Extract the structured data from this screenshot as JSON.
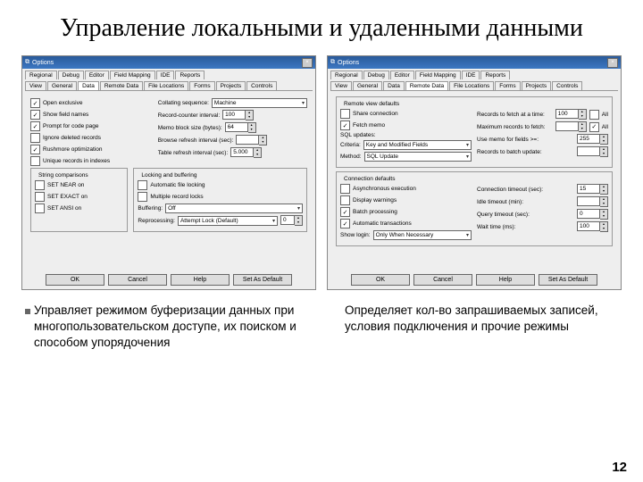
{
  "slide_title": "Управление локальными и удаленными данными",
  "caption_left": "Управляет режимом буферизации данных при многопользовательском доступе, их поиском и способом упорядочения",
  "caption_right": "Определяет кол-во запрашиваемых записей, условия подключения и прочие режимы",
  "page_number": "12",
  "left": {
    "title": "Options",
    "tabs1": [
      "Regional",
      "Debug",
      "Editor",
      "Field Mapping",
      "IDE",
      "Reports"
    ],
    "tabs2": [
      "View",
      "General",
      "Data",
      "Remote Data",
      "File Locations",
      "Forms",
      "Projects",
      "Controls"
    ],
    "sel_tab": 2,
    "open_exclusive": "Open exclusive",
    "show_field_names": "Show field names",
    "prompt_code_page": "Prompt for code page",
    "ignore_deleted": "Ignore deleted records",
    "rushmore": "Rushmore optimization",
    "unique_idx": "Unique records in indexes",
    "collating_lbl": "Collating sequence:",
    "collating_val": "Machine",
    "record_counter_lbl": "Record-counter interval:",
    "record_counter_val": "100",
    "memo_lbl": "Memo block size (bytes):",
    "memo_val": "64",
    "browse_refresh_lbl": "Browse refresh interval (sec):",
    "table_refresh_lbl": "Table refresh interval (sec):",
    "table_refresh_val": "5.000",
    "string_group": "String comparisons",
    "set_near": "SET NEAR on",
    "set_exact": "SET EXACT on",
    "set_ansi": "SET ANSI on",
    "locking_group": "Locking and buffering",
    "auto_lock": "Automatic file locking",
    "multi_lock": "Multiple record locks",
    "buffering_lbl": "Buffering:",
    "buffering_val": "Off",
    "reprocessing_lbl": "Reprocessing:",
    "reprocessing_val": "Attempt Lock (Default)",
    "reprocessing_n": "0"
  },
  "right": {
    "title": "Options",
    "tabs1": [
      "Regional",
      "Debug",
      "Editor",
      "Field Mapping",
      "IDE",
      "Reports"
    ],
    "tabs2": [
      "View",
      "General",
      "Data",
      "Remote Data",
      "File Locations",
      "Forms",
      "Projects",
      "Controls"
    ],
    "sel_tab": 3,
    "remote_group": "Remote view defaults",
    "share_conn": "Share connection",
    "fetch_memo": "Fetch memo",
    "sql_updates": "SQL updates:",
    "criteria_lbl": "Criteria:",
    "criteria_val": "Key and Modified Fields",
    "method_lbl": "Method:",
    "method_val": "SQL Update",
    "records_fetch_lbl": "Records to fetch at a time:",
    "records_fetch_val": "100",
    "max_records_lbl": "Maximum records to fetch:",
    "use_memo_lbl": "Use memo for fields >=:",
    "use_memo_val": "255",
    "records_batch_lbl": "Records to batch update:",
    "all1": "All",
    "all2": "All",
    "conn_group": "Connection defaults",
    "async": "Asynchronous execution",
    "display_warn": "Display warnings",
    "batch_proc": "Batch processing",
    "auto_trans": "Automatic transactions",
    "show_login_lbl": "Show login:",
    "show_login_val": "Only When Necessary",
    "conn_timeout_lbl": "Connection timeout (sec):",
    "conn_timeout_val": "15",
    "idle_timeout_lbl": "Idle timeout (min):",
    "query_timeout_lbl": "Query timeout (sec):",
    "query_timeout_val": "0",
    "wait_time_lbl": "Wait time (ms):",
    "wait_time_val": "100"
  },
  "buttons": {
    "ok": "OK",
    "cancel": "Cancel",
    "help": "Help",
    "set_default": "Set As Default"
  }
}
